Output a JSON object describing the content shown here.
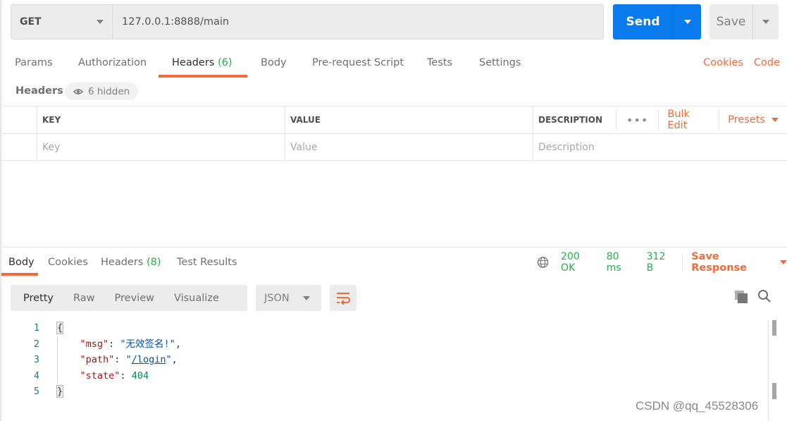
{
  "request": {
    "method": "GET",
    "url": "127.0.0.1:8888/main",
    "send_label": "Send",
    "save_label": "Save"
  },
  "request_tabs": [
    {
      "label": "Params"
    },
    {
      "label": "Authorization"
    },
    {
      "label": "Headers",
      "count": "(6)",
      "active": true
    },
    {
      "label": "Body"
    },
    {
      "label": "Pre-request Script"
    },
    {
      "label": "Tests"
    },
    {
      "label": "Settings"
    }
  ],
  "right_links": {
    "cookies": "Cookies",
    "code": "Code"
  },
  "headers_section": {
    "label": "Headers",
    "hidden_badge": "6 hidden"
  },
  "headers_table": {
    "columns": [
      "KEY",
      "VALUE",
      "DESCRIPTION"
    ],
    "more_label": "•••",
    "bulk_edit": "Bulk Edit",
    "presets": "Presets",
    "placeholders": {
      "key": "Key",
      "value": "Value",
      "description": "Description"
    }
  },
  "response_tabs": [
    {
      "label": "Body",
      "active": true
    },
    {
      "label": "Cookies"
    },
    {
      "label": "Headers",
      "count": "(8)"
    },
    {
      "label": "Test Results"
    }
  ],
  "response_status": {
    "status": "200 OK",
    "time": "80 ms",
    "size": "312 B",
    "save_response": "Save Response"
  },
  "view_modes": [
    "Pretty",
    "Raw",
    "Preview",
    "Visualize"
  ],
  "active_view_mode": "Pretty",
  "format": "JSON",
  "code": {
    "line_numbers": [
      "1",
      "2",
      "3",
      "4",
      "5"
    ],
    "open_brace": "{",
    "close_brace": "}",
    "msg_key": "\"msg\"",
    "msg_value": "\"无效签名!\"",
    "path_key": "\"path\"",
    "path_value": "/login",
    "state_key": "\"state\"",
    "state_value": "404"
  },
  "watermark": "CSDN @qq_45528306",
  "colors": {
    "accent_orange": "#f26b3a",
    "send_blue": "#097bed",
    "success_green": "#26b047"
  }
}
